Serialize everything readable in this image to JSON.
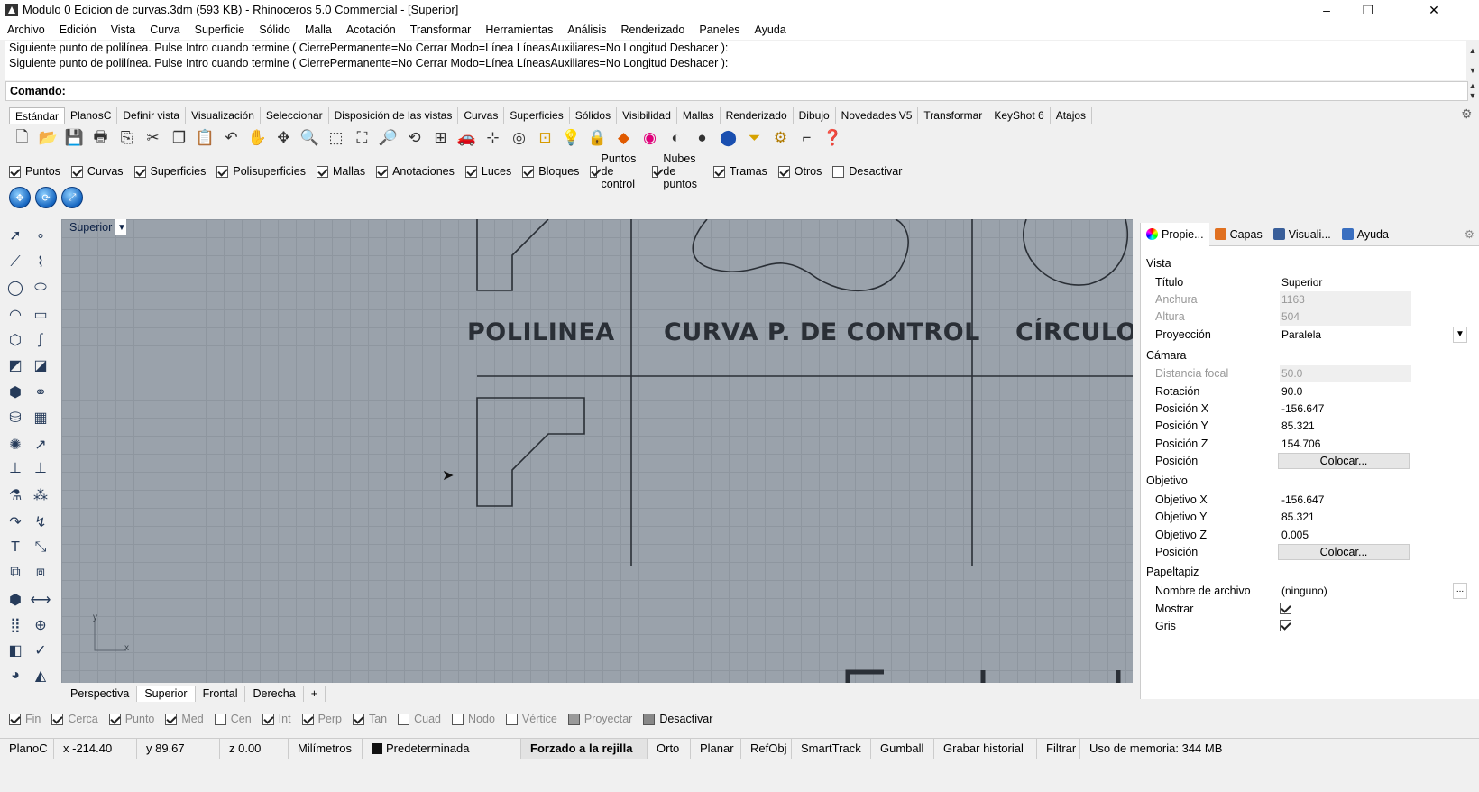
{
  "window": {
    "title": "Modulo 0 Edicion de curvas.3dm (593 KB) - Rhinoceros 5.0 Commercial - [Superior]",
    "minimize": "–",
    "maximize": "❐",
    "close": "✕"
  },
  "menu": [
    "Archivo",
    "Edición",
    "Vista",
    "Curva",
    "Superficie",
    "Sólido",
    "Malla",
    "Acotación",
    "Transformar",
    "Herramientas",
    "Análisis",
    "Renderizado",
    "Paneles",
    "Ayuda"
  ],
  "command": {
    "history": [
      "Siguiente punto de polilínea. Pulse Intro cuando termine ( CierrePermanente=No  Cerrar  Modo=Línea  LíneasAuxiliares=No  Longitud  Deshacer ):",
      "Siguiente punto de polilínea. Pulse Intro cuando termine ( CierrePermanente=No  Cerrar  Modo=Línea  LíneasAuxiliares=No  Longitud  Deshacer ):"
    ],
    "prompt": "Comando:"
  },
  "toolbar_tabs": [
    "Estándar",
    "PlanosC",
    "Definir vista",
    "Visualización",
    "Seleccionar",
    "Disposición de las vistas",
    "Curvas",
    "Superficies",
    "Sólidos",
    "Visibilidad",
    "Mallas",
    "Renderizado",
    "Dibujo",
    "Novedades V5",
    "Transformar",
    "KeyShot 6",
    "Atajos"
  ],
  "toolbar_icons": [
    "new-icon",
    "open-icon",
    "save-icon",
    "print-icon",
    "import-icon",
    "cut-icon",
    "copy-icon",
    "paste-icon",
    "undo-icon",
    "pan-icon",
    "move-view-icon",
    "zoom-icon",
    "zoom-window-icon",
    "zoom-extents-icon",
    "zoom-selected-icon",
    "rotate-view-icon",
    "four-views-icon",
    "car-icon",
    "point-icon",
    "circle-icon",
    "grid-snap-icon",
    "light-icon",
    "lock-icon",
    "layer-icon",
    "color-wheel-icon",
    "shade-icon",
    "render-icon",
    "sphere-icon",
    "cone-icon",
    "gear-icon",
    "dimension-icon",
    "help-icon"
  ],
  "filters": [
    {
      "label": "Puntos",
      "checked": true
    },
    {
      "label": "Curvas",
      "checked": true
    },
    {
      "label": "Superficies",
      "checked": true
    },
    {
      "label": "Polisuperficies",
      "checked": true
    },
    {
      "label": "Mallas",
      "checked": true
    },
    {
      "label": "Anotaciones",
      "checked": true
    },
    {
      "label": "Luces",
      "checked": true
    },
    {
      "label": "Bloques",
      "checked": true
    },
    {
      "label": "Puntos de control",
      "checked": true
    },
    {
      "label": "Nubes de puntos",
      "checked": true
    },
    {
      "label": "Tramas",
      "checked": true
    },
    {
      "label": "Otros",
      "checked": true
    },
    {
      "label": "Desactivar",
      "checked": false
    }
  ],
  "viewport": {
    "title": "Superior",
    "labels": {
      "polilinea": "POLILINEA",
      "curva": "CURVA  P. DE CONTROL",
      "circulo": "CÍRCULO"
    },
    "axis_x": "x",
    "axis_y": "y"
  },
  "view_tabs": [
    "Perspectiva",
    "Superior",
    "Frontal",
    "Derecha",
    "+"
  ],
  "osnaps": [
    {
      "label": "Fin",
      "checked": true
    },
    {
      "label": "Cerca",
      "checked": true
    },
    {
      "label": "Punto",
      "checked": true
    },
    {
      "label": "Med",
      "checked": true
    },
    {
      "label": "Cen",
      "checked": false
    },
    {
      "label": "Int",
      "checked": true
    },
    {
      "label": "Perp",
      "checked": true
    },
    {
      "label": "Tan",
      "checked": true
    },
    {
      "label": "Cuad",
      "checked": false
    },
    {
      "label": "Nodo",
      "checked": false
    },
    {
      "label": "Vértice",
      "checked": false
    },
    {
      "label": "Proyectar",
      "checked": false
    },
    {
      "label": "Desactivar",
      "checked": false
    }
  ],
  "status": {
    "plane": "PlanoC",
    "x": "x -214.40",
    "y": "y 89.67",
    "z": "z 0.00",
    "units": "Milímetros",
    "layer": "Predeterminada",
    "grid": "Forzado a la rejilla",
    "ortho": "Orto",
    "planar": "Planar",
    "osnap": "RefObj",
    "smarttrack": "SmartTrack",
    "gumball": "Gumball",
    "history": "Grabar historial",
    "filter": "Filtrar",
    "memory": "Uso de memoria: 344 MB"
  },
  "panel": {
    "tabs": [
      "Propie...",
      "Capas",
      "Visuali...",
      "Ayuda"
    ],
    "tab_colors": [
      "#d8462a",
      "#e07020",
      "#3a5f9a",
      "#3a6fc0"
    ],
    "groups": {
      "vista": "Vista",
      "camara": "Cámara",
      "objetivo": "Objetivo",
      "papel": "Papeltapiz"
    },
    "rows": {
      "titulo": {
        "k": "Título",
        "v": "Superior"
      },
      "anchura": {
        "k": "Anchura",
        "v": "1163"
      },
      "altura": {
        "k": "Altura",
        "v": "504"
      },
      "proyeccion": {
        "k": "Proyección",
        "v": "Paralela"
      },
      "distfocal": {
        "k": "Distancia focal",
        "v": "50.0"
      },
      "rotacion": {
        "k": "Rotación",
        "v": "90.0"
      },
      "posx": {
        "k": "Posición X",
        "v": "-156.647"
      },
      "posy": {
        "k": "Posición Y",
        "v": "85.321"
      },
      "posz": {
        "k": "Posición Z",
        "v": "154.706"
      },
      "pos1": {
        "k": "Posición",
        "v": "Colocar..."
      },
      "objx": {
        "k": "Objetivo X",
        "v": "-156.647"
      },
      "objy": {
        "k": "Objetivo Y",
        "v": "85.321"
      },
      "objz": {
        "k": "Objetivo Z",
        "v": "0.005"
      },
      "pos2": {
        "k": "Posición",
        "v": "Colocar..."
      },
      "archivo": {
        "k": "Nombre de archivo",
        "v": "(ninguno)"
      },
      "mostrar": {
        "k": "Mostrar",
        "checked": true
      },
      "gris": {
        "k": "Gris",
        "checked": true
      }
    }
  }
}
